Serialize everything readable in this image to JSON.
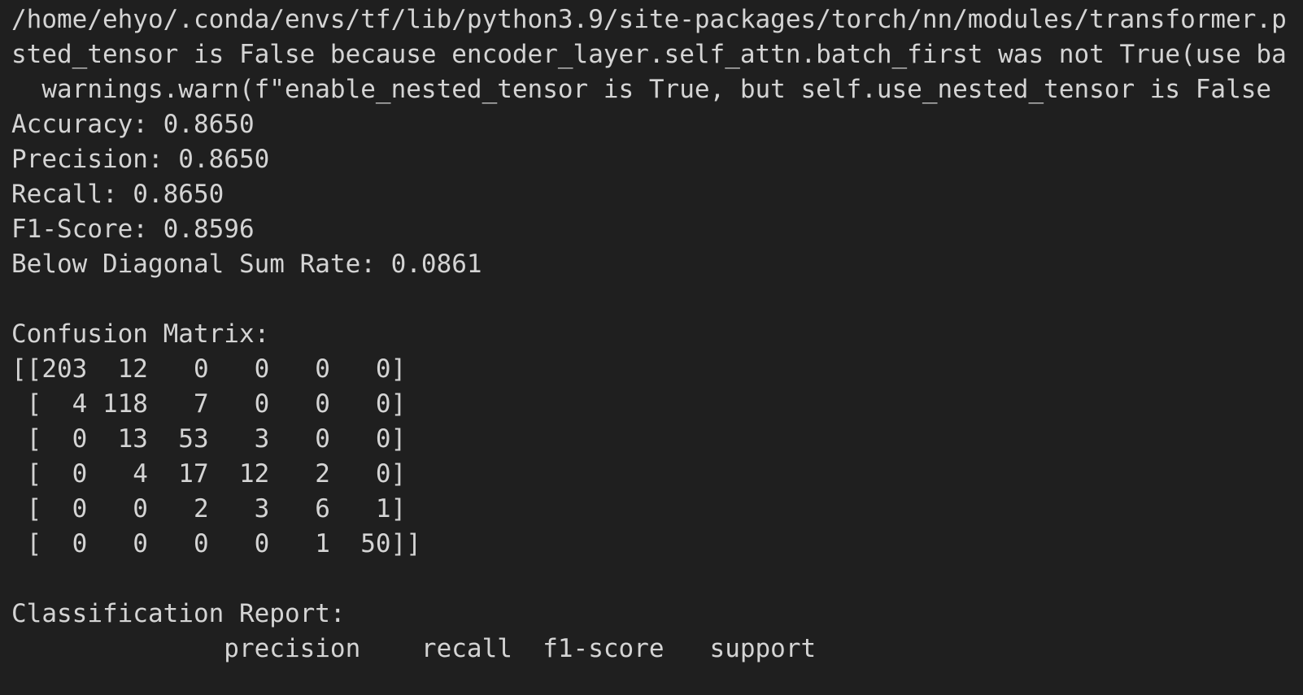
{
  "terminal": {
    "warning_lines": [
      "/home/ehyo/.conda/envs/tf/lib/python3.9/site-packages/torch/nn/modules/transformer.p",
      "sted_tensor is False because encoder_layer.self_attn.batch_first was not True(use ba",
      "  warnings.warn(f\"enable_nested_tensor is True, but self.use_nested_tensor is False"
    ],
    "metrics": {
      "accuracy": "Accuracy: 0.8650",
      "precision": "Precision: 0.8650",
      "recall": "Recall: 0.8650",
      "f1": "F1-Score: 0.8596",
      "below_diagonal": "Below Diagonal Sum Rate: 0.0861"
    },
    "confusion_title": "Confusion Matrix:",
    "confusion_rows": [
      "[[203  12   0   0   0   0]",
      " [  4 118   7   0   0   0]",
      " [  0  13  53   3   0   0]",
      " [  0   4  17  12   2   0]",
      " [  0   0   2   3   6   1]",
      " [  0   0   0   0   1  50]]"
    ],
    "report_title": "Classification Report:",
    "report_header": "              precision    recall  f1-score   support"
  },
  "colors": {
    "background": "#1f1f1f",
    "text": "#d4d4d4"
  }
}
